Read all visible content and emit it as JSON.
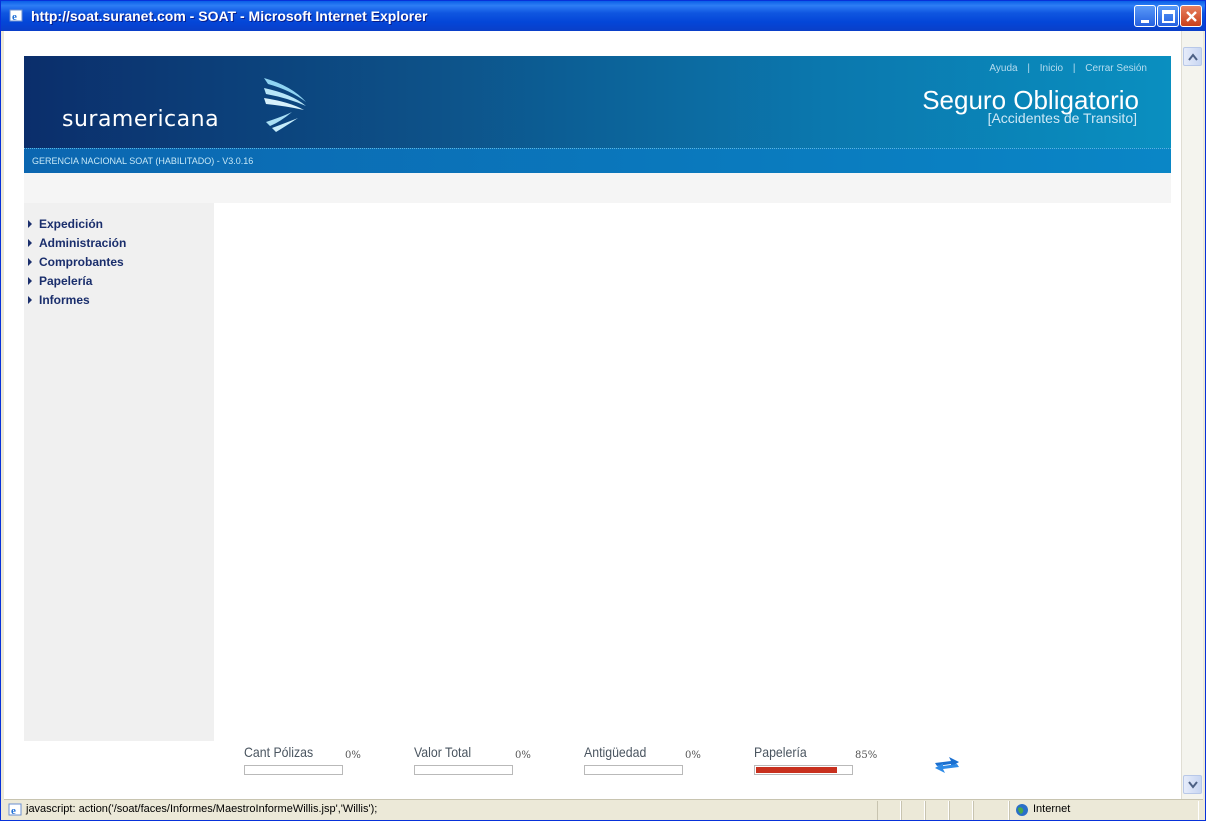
{
  "window": {
    "title": "http://soat.suranet.com - SOAT - Microsoft Internet Explorer",
    "icon": "ie-icon"
  },
  "header": {
    "logo_text": "suramericana",
    "links": [
      "Ayuda",
      "Inicio",
      "Cerrar Sesión"
    ],
    "link_separator": "|",
    "product_title": "Seguro Obligatorio",
    "product_subtitle": "[Accidentes de Transito]"
  },
  "subbar": {
    "text": "GERENCIA NACIONAL SOAT (HABILITADO) - V3.0.16"
  },
  "sidebar": {
    "items": [
      {
        "label": "Expedición"
      },
      {
        "label": "Administración"
      },
      {
        "label": "Comprobantes"
      },
      {
        "label": "Papelería"
      },
      {
        "label": "Informes"
      }
    ]
  },
  "indicators": [
    {
      "label": "Cant Pólizas",
      "percent_text": "0%",
      "value": 0
    },
    {
      "label": "Valor Total",
      "percent_text": "0%",
      "value": 0
    },
    {
      "label": "Antigüedad",
      "percent_text": "0%",
      "value": 0
    },
    {
      "label": "Papelería",
      "percent_text": "85%",
      "value": 0.85
    }
  ],
  "status_bar": {
    "text": "javascript: action('/soat/faces/Informes/MaestroInformeWillis.jsp','Willis');",
    "zone": "Internet"
  },
  "colors": {
    "titlebar": "#0a5fe8",
    "header_dark": "#0b2e6b",
    "header_light": "#0a8fc0",
    "nav_text": "#1a2e6c",
    "progress_fill": "#c8301e",
    "refresh_icon": "#1a6fd0"
  }
}
